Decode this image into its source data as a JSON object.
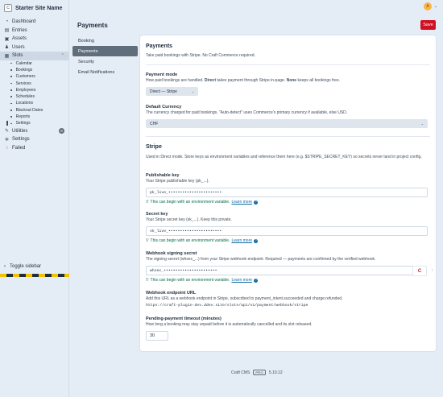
{
  "site": {
    "icon_letter": "C",
    "name": "Starter Site Name"
  },
  "user": {
    "initial": "A"
  },
  "nav": {
    "items": [
      {
        "id": "dashboard",
        "label": "Dashboard",
        "icon": "gauge-icon"
      },
      {
        "id": "entries",
        "label": "Entries",
        "icon": "newspaper-icon"
      },
      {
        "id": "assets",
        "label": "Assets",
        "icon": "image-icon"
      },
      {
        "id": "users",
        "label": "Users",
        "icon": "users-icon"
      },
      {
        "id": "slots",
        "label": "Slots",
        "icon": "calendar-icon"
      }
    ],
    "slots_sub": [
      "Calendar",
      "Bookings",
      "Customers",
      "Services",
      "Employees",
      "Schedules",
      "Locations",
      "Blackout Dates",
      "Reports",
      "Settings"
    ],
    "lower_items": [
      {
        "id": "utilities",
        "label": "Utilities",
        "icon": "wrench-icon",
        "badge": "8"
      },
      {
        "id": "settings",
        "label": "Settings",
        "icon": "gear-icon"
      },
      {
        "id": "failed",
        "label": "Failed",
        "icon": "failed-ring-icon"
      }
    ],
    "toggle_label": "Toggle sidebar"
  },
  "page": {
    "title": "Payments",
    "save_label": "Save"
  },
  "subnav": [
    "Booking",
    "Payments",
    "Security",
    "Email Notifications"
  ],
  "payments": {
    "heading": "Payments",
    "intro": "Take paid bookings with Stripe. No Craft Commerce required.",
    "mode": {
      "label": "Payment mode",
      "help_a": "How paid bookings are handled. ",
      "help_b": "Direct",
      "help_c": " takes payment through Stripe in-page. ",
      "help_d": "None",
      "help_e": " keeps all bookings free.",
      "value": "Direct — Stripe"
    },
    "currency": {
      "label": "Default Currency",
      "help": "The currency charged for paid bookings. \"Auto-detect\" uses Commerce's primary currency if available, else USD.",
      "value": "CHF"
    }
  },
  "stripe": {
    "heading": "Stripe",
    "intro": "Used in Direct mode. Store keys as environment variables and reference them here (e.g. $STRIPE_SECRET_KEY) so secrets never land in project config.",
    "env_tip": "This can begin with an environment variable.",
    "learn_more": "Learn more",
    "pk": {
      "label": "Publishable key",
      "help": "Your Stripe publishable key (pk_...).",
      "value": "pk_live_•••••••••••••••••••••••"
    },
    "sk": {
      "label": "Secret key",
      "help": "Your Stripe secret key (sk_...). Keep this private.",
      "value": "sk_live_•••••••••••••••••••••••"
    },
    "whsec": {
      "label": "Webhook signing secret",
      "help": "The signing secret (whsec_...) from your Stripe webhook endpoint. Required — payments are confirmed by the verified webhook.",
      "value": "whsec_•••••••••••••••••••••••"
    },
    "endpoint": {
      "label": "Webhook endpoint URL",
      "help": "Add this URL as a webhook endpoint in Stripe, subscribed to payment_intent.succeeded and charge.refunded.",
      "url": "https://craft-plugin-dev.ddev.site/slots/api/v1/payment/webhook/stripe"
    },
    "timeout": {
      "label": "Pending-payment timeout (minutes)",
      "help": "How long a booking may stay unpaid before it is automatically cancelled and its slot released.",
      "value": "30"
    }
  },
  "footer": {
    "product": "Craft CMS",
    "edition": "PRO",
    "version": "5.10.12"
  }
}
